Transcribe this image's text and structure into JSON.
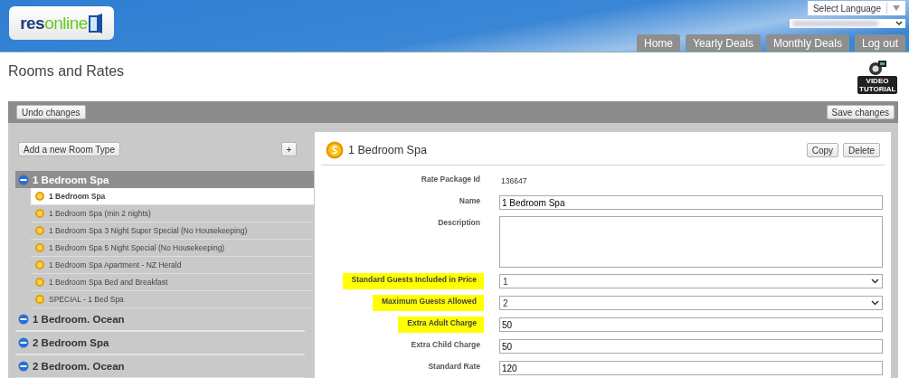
{
  "header": {
    "logo_bold": "res",
    "logo_light": "online",
    "language_select": "Select Language",
    "nav": [
      {
        "label": "Home"
      },
      {
        "label": "Yearly Deals"
      },
      {
        "label": "Monthly Deals"
      },
      {
        "label": "Log out"
      }
    ]
  },
  "page_title": "Rooms and Rates",
  "video_tutorial": "VIDEO TUTORIAL",
  "toolbar": {
    "undo": "Undo changes",
    "save": "Save changes"
  },
  "sidebar": {
    "add_button": "Add a new Room Type",
    "plus_button": "+",
    "room_types": [
      {
        "name": "1 Bedroom Spa",
        "expanded": true,
        "children": [
          {
            "name": "1 Bedroom Spa",
            "selected": true
          },
          {
            "name": "1 Bedroom Spa (min 2 nights)",
            "selected": false
          },
          {
            "name": "1 Bedroom Spa 3 Night Super Special (No Housekeeping)",
            "selected": false
          },
          {
            "name": "1 Bedroom Spa 5 Night Special (No Housekeeping)",
            "selected": false
          },
          {
            "name": "1 Bedroom Spa Apartment - NZ Herald",
            "selected": false
          },
          {
            "name": "1 Bedroom Spa Bed and Breakfast",
            "selected": false
          },
          {
            "name": "SPECIAL - 1 Bed Spa",
            "selected": false
          }
        ]
      },
      {
        "name": "1 Bedroom. Ocean",
        "expanded": false
      },
      {
        "name": "2 Bedroom Spa",
        "expanded": false
      },
      {
        "name": "2 Bedroom. Ocean",
        "expanded": false
      }
    ]
  },
  "detail": {
    "title": "1 Bedroom Spa",
    "buttons": [
      "Copy",
      "Delete"
    ],
    "fields": [
      {
        "label": "Rate Package Id",
        "kind": "static",
        "value": "136647",
        "highlighted": false
      },
      {
        "label": "Name",
        "kind": "text",
        "value": "1 Bedroom Spa",
        "highlighted": false
      },
      {
        "label": "Description",
        "kind": "textarea",
        "highlighted": false
      },
      {
        "label": "Standard Guests Included in Price",
        "kind": "select",
        "value": "1",
        "highlighted": true
      },
      {
        "label": "Maximum Guests Allowed",
        "kind": "select",
        "value": "2",
        "highlighted": true
      },
      {
        "label": "Extra Adult Charge",
        "kind": "text",
        "value": "50",
        "highlighted": true
      },
      {
        "label": "Extra Child Charge",
        "kind": "text",
        "value": "50",
        "highlighted": false
      },
      {
        "label": "Standard Rate",
        "kind": "text",
        "value": "120",
        "highlighted": false
      }
    ]
  }
}
